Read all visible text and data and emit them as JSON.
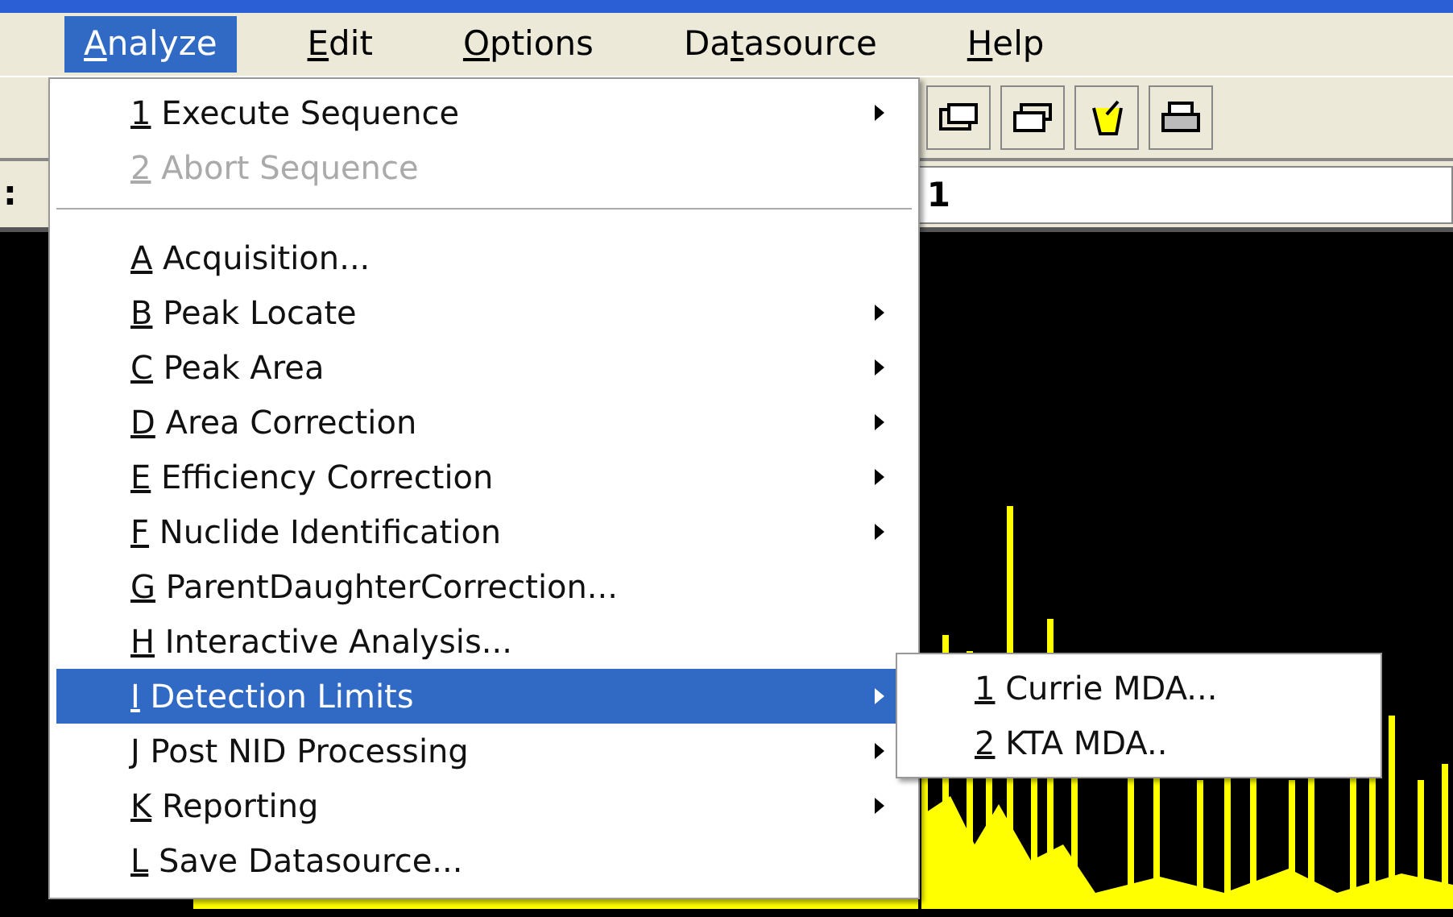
{
  "menubar": [
    {
      "key": "A",
      "rest": "nalyze",
      "selected": true
    },
    {
      "key": "E",
      "rest": "dit",
      "selected": false
    },
    {
      "key": "O",
      "rest": "ptions",
      "selected": false
    },
    {
      "pre": "Da",
      "key": "t",
      "rest": "asource",
      "selected": false
    },
    {
      "key": "H",
      "rest": "elp",
      "selected": false
    }
  ],
  "field_row": {
    "label": ":",
    "value": "1"
  },
  "menu": {
    "items": [
      {
        "kind": "item",
        "text": "1 Execute Sequence",
        "submenu": true,
        "disabled": false,
        "selected": false
      },
      {
        "kind": "item",
        "text": "2 Abort Sequence",
        "submenu": false,
        "disabled": true,
        "selected": false
      },
      {
        "kind": "separator"
      },
      {
        "kind": "item",
        "text": "A Acquisition...",
        "submenu": false,
        "disabled": false,
        "selected": false
      },
      {
        "kind": "item",
        "text": "B Peak Locate",
        "submenu": true,
        "disabled": false,
        "selected": false
      },
      {
        "kind": "item",
        "text": "C Peak Area",
        "submenu": true,
        "disabled": false,
        "selected": false
      },
      {
        "kind": "item",
        "text": "D Area Correction",
        "submenu": true,
        "disabled": false,
        "selected": false
      },
      {
        "kind": "item",
        "text": "E Efficiency Correction",
        "submenu": true,
        "disabled": false,
        "selected": false
      },
      {
        "kind": "item",
        "text": "F Nuclide Identification",
        "submenu": true,
        "disabled": false,
        "selected": false
      },
      {
        "kind": "item",
        "text": "G ParentDaughterCorrection...",
        "submenu": false,
        "disabled": false,
        "selected": false
      },
      {
        "kind": "item",
        "text": "H Interactive Analysis...",
        "submenu": false,
        "disabled": false,
        "selected": false
      },
      {
        "kind": "item",
        "text": "I Detection Limits",
        "submenu": true,
        "disabled": false,
        "selected": true
      },
      {
        "kind": "item",
        "text": "J Post NID Processing",
        "submenu": true,
        "disabled": false,
        "selected": false
      },
      {
        "kind": "item",
        "text": "K Reporting",
        "submenu": true,
        "disabled": false,
        "selected": false
      },
      {
        "kind": "item",
        "text": "L Save Datasource...",
        "submenu": false,
        "disabled": false,
        "selected": false
      }
    ]
  },
  "submenu": {
    "items": [
      {
        "text": "1 Currie MDA...",
        "selected": false
      },
      {
        "text": "2 KTA MDA..",
        "selected": false
      }
    ]
  }
}
